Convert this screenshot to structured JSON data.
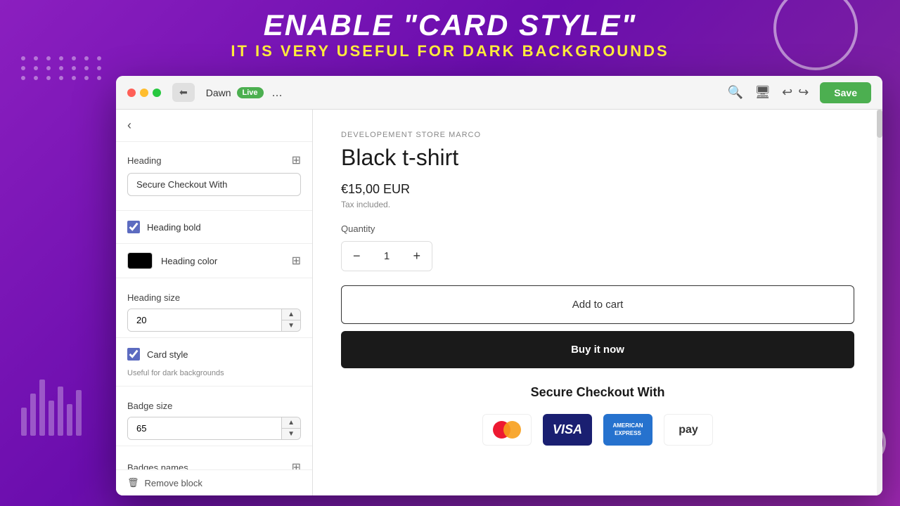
{
  "banner": {
    "title": "Enable \"Card style\"",
    "subtitle": "It is very useful for dark backgrounds"
  },
  "browser": {
    "theme_name": "Dawn",
    "live_label": "Live",
    "save_label": "Save",
    "more_options": "..."
  },
  "sidebar": {
    "heading_label": "Heading",
    "heading_value": "Secure Checkout With",
    "heading_bold_label": "Heading bold",
    "heading_bold_checked": true,
    "heading_color_label": "Heading color",
    "heading_size_label": "Heading size",
    "heading_size_value": "20",
    "card_style_label": "Card style",
    "card_style_checked": true,
    "card_style_hint": "Useful for dark backgrounds",
    "badge_size_label": "Badge size",
    "badge_size_value": "65",
    "badges_names_label": "Badges names",
    "remove_block_label": "Remove block"
  },
  "preview": {
    "store_name": "DEVELOPEMENT STORE MARCO",
    "product_title": "Black t-shirt",
    "price": "€15,00 EUR",
    "tax_text": "Tax included.",
    "quantity_label": "Quantity",
    "quantity_value": "1",
    "add_to_cart_label": "Add to cart",
    "buy_now_label": "Buy it now",
    "checkout_heading": "Secure Checkout With",
    "payment_methods": [
      "Mastercard",
      "VISA",
      "AMERICAN EXPRESS",
      "pay"
    ]
  }
}
